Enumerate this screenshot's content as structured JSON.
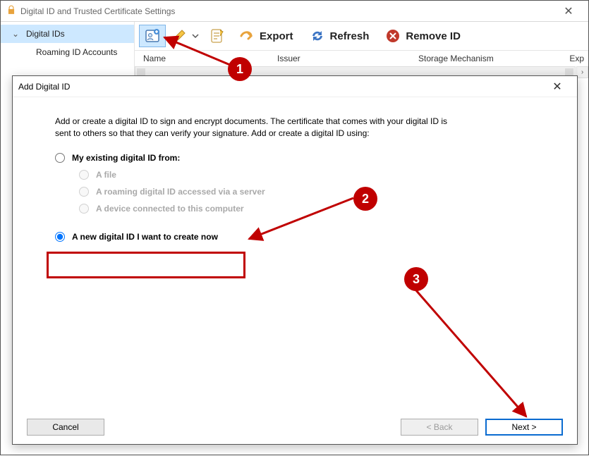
{
  "parent": {
    "title": "Digital ID and Trusted Certificate Settings",
    "sidebar": {
      "items": [
        {
          "label": "Digital IDs"
        },
        {
          "label": "Roaming ID Accounts"
        }
      ]
    },
    "toolbar": {
      "export": "Export",
      "refresh": "Refresh",
      "remove": "Remove ID"
    },
    "columns": {
      "name": "Name",
      "issuer": "Issuer",
      "storage": "Storage Mechanism",
      "expires": "Exp"
    }
  },
  "dialog": {
    "title": "Add Digital ID",
    "intro": "Add or create a digital ID to sign and encrypt documents. The certificate that comes with your digital ID is sent to others so that they can verify your signature. Add or create a digital ID using:",
    "opt_existing": "My existing digital ID from:",
    "sub_file": "A file",
    "sub_roaming": "A roaming digital ID accessed via a server",
    "sub_device": "A device connected to this computer",
    "opt_new": "A new digital ID I want to create now",
    "buttons": {
      "cancel": "Cancel",
      "back": "< Back",
      "next": "Next >"
    }
  },
  "annotations": {
    "n1": "1",
    "n2": "2",
    "n3": "3"
  }
}
